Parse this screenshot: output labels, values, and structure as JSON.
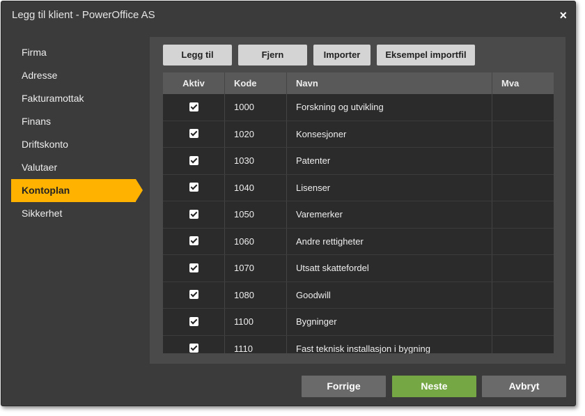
{
  "window": {
    "title": "Legg til klient - PowerOffice AS",
    "close_glyph": "×"
  },
  "nav": {
    "items": [
      {
        "label": "Firma"
      },
      {
        "label": "Adresse"
      },
      {
        "label": "Fakturamottak"
      },
      {
        "label": "Finans"
      },
      {
        "label": "Driftskonto"
      },
      {
        "label": "Valutaer"
      },
      {
        "label": "Kontoplan",
        "active": true
      },
      {
        "label": "Sikkerhet"
      }
    ]
  },
  "toolbar": {
    "add_label": "Legg til",
    "remove_label": "Fjern",
    "import_label": "Importer",
    "example_label": "Eksempel importfil"
  },
  "table": {
    "columns": [
      "Aktiv",
      "Kode",
      "Navn",
      "Mva"
    ],
    "rows": [
      {
        "aktiv": true,
        "kode": "1000",
        "navn": "Forskning og utvikling",
        "mva": ""
      },
      {
        "aktiv": true,
        "kode": "1020",
        "navn": "Konsesjoner",
        "mva": ""
      },
      {
        "aktiv": true,
        "kode": "1030",
        "navn": "Patenter",
        "mva": ""
      },
      {
        "aktiv": true,
        "kode": "1040",
        "navn": "Lisenser",
        "mva": ""
      },
      {
        "aktiv": true,
        "kode": "1050",
        "navn": "Varemerker",
        "mva": ""
      },
      {
        "aktiv": true,
        "kode": "1060",
        "navn": "Andre rettigheter",
        "mva": ""
      },
      {
        "aktiv": true,
        "kode": "1070",
        "navn": "Utsatt skattefordel",
        "mva": ""
      },
      {
        "aktiv": true,
        "kode": "1080",
        "navn": "Goodwill",
        "mva": ""
      },
      {
        "aktiv": true,
        "kode": "1100",
        "navn": "Bygninger",
        "mva": ""
      },
      {
        "aktiv": true,
        "kode": "1110",
        "navn": "Fast teknisk installasjon i bygning",
        "mva": ""
      }
    ]
  },
  "footer": {
    "prev_label": "Forrige",
    "next_label": "Neste",
    "cancel_label": "Avbryt"
  },
  "colors": {
    "accent": "#ffb200",
    "next_button": "#76a745",
    "dialog_bg": "#3b3b3b"
  }
}
